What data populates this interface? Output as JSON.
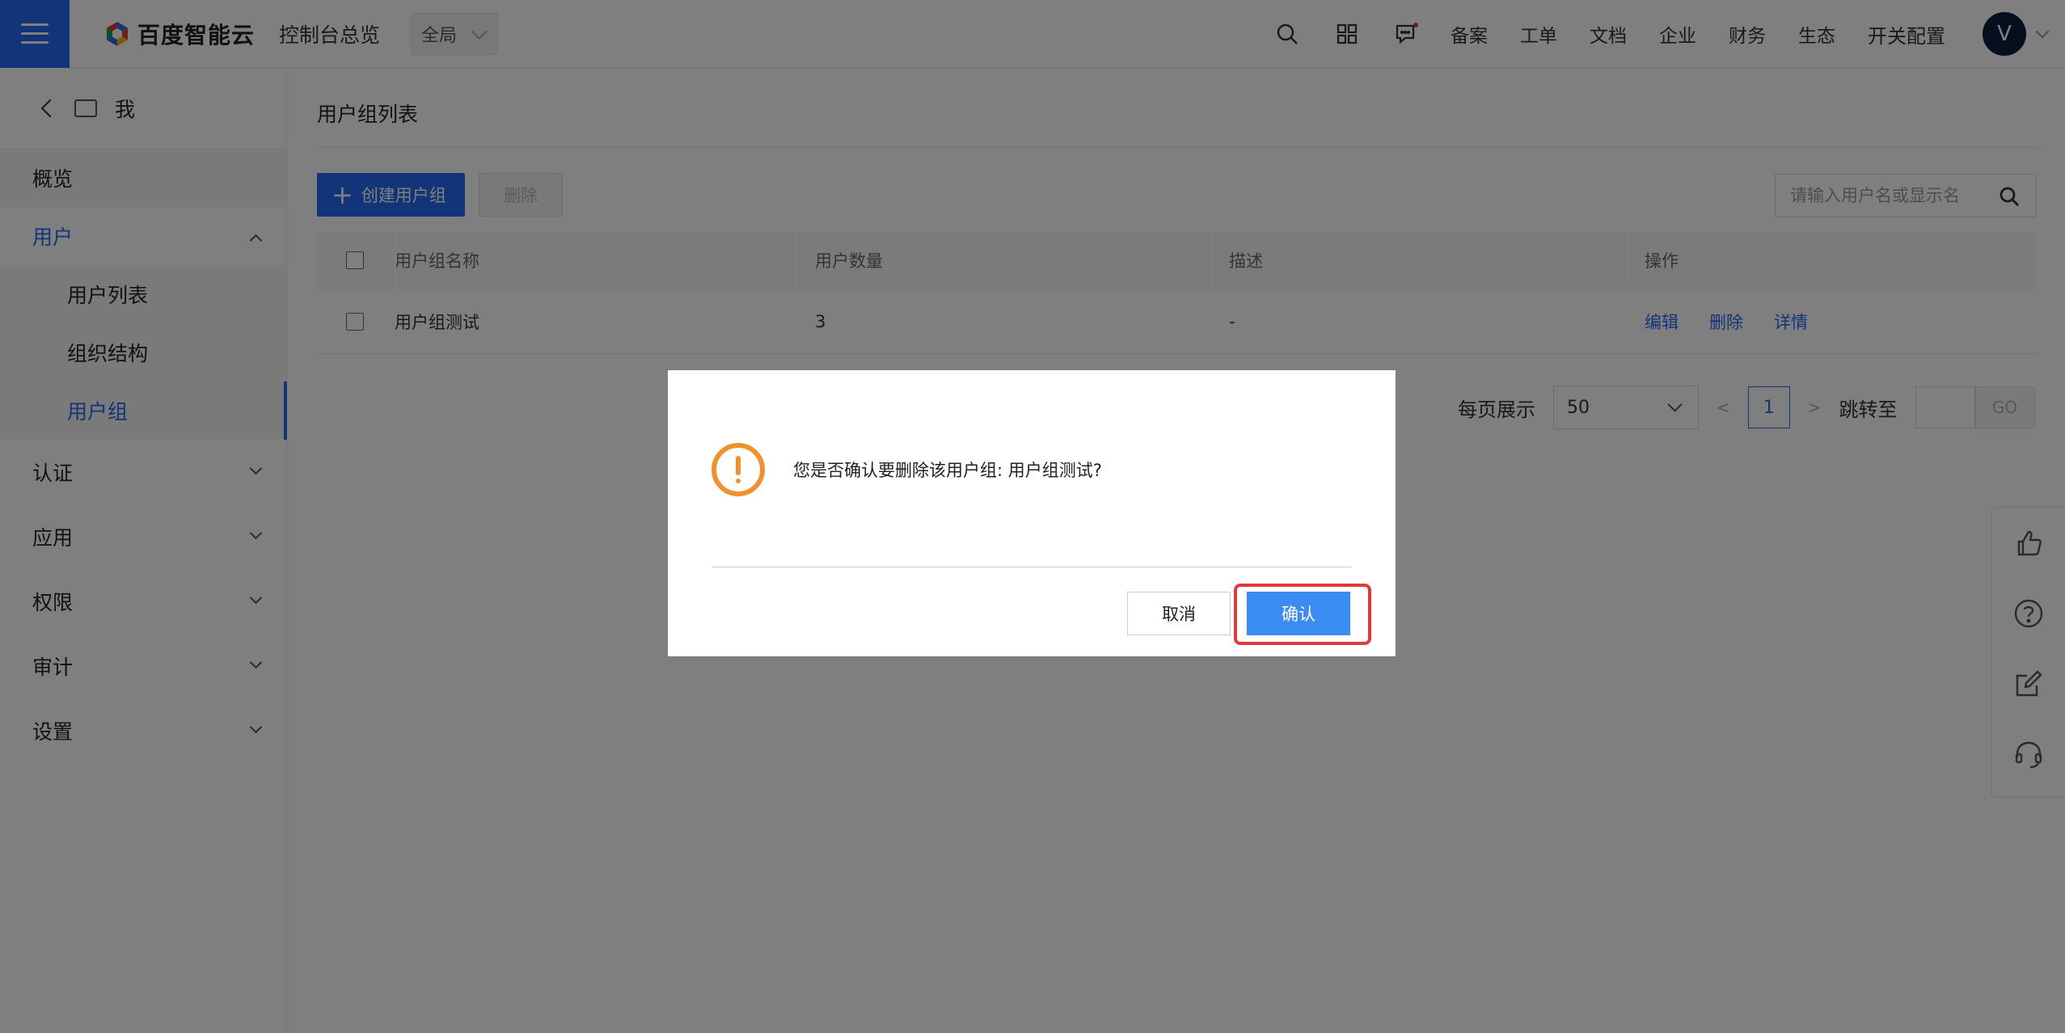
{
  "topbar": {
    "logo_text": "百度智能云",
    "console_title": "控制台总览",
    "region": "全局",
    "nav_links": [
      "备案",
      "工单",
      "文档",
      "企业",
      "财务",
      "生态"
    ],
    "switch_config": "开关配置",
    "avatar_letter": "V",
    "brand_color": "#2468f2"
  },
  "sidebar": {
    "header": "我",
    "overview": "概览",
    "users": "用户",
    "user_subitems": [
      "用户列表",
      "组织结构",
      "用户组"
    ],
    "active_subitem": "用户组",
    "sections": [
      "认证",
      "应用",
      "权限",
      "审计",
      "设置"
    ]
  },
  "main": {
    "page_title": "用户组列表",
    "create_button": "创建用户组",
    "delete_button": "删除",
    "search_placeholder": "请输入用户名或显示名",
    "table": {
      "headers": [
        "用户组名称",
        "用户数量",
        "描述",
        "操作"
      ],
      "rows": [
        {
          "name": "用户组测试",
          "count": "3",
          "desc": "-",
          "actions": [
            "编辑",
            "删除",
            "详情"
          ]
        }
      ]
    },
    "pagination": {
      "per_page_label": "每页展示",
      "per_page": "50",
      "prev": "<",
      "current_page": "1",
      "next": ">",
      "goto_label": "跳转至",
      "go_button": "GO"
    }
  },
  "modal": {
    "message": "您是否确认要删除该用户组: 用户组测试?",
    "cancel": "取消",
    "confirm": "确认",
    "warning_color": "#f0912b",
    "highlight_color": "#e03a3a"
  }
}
